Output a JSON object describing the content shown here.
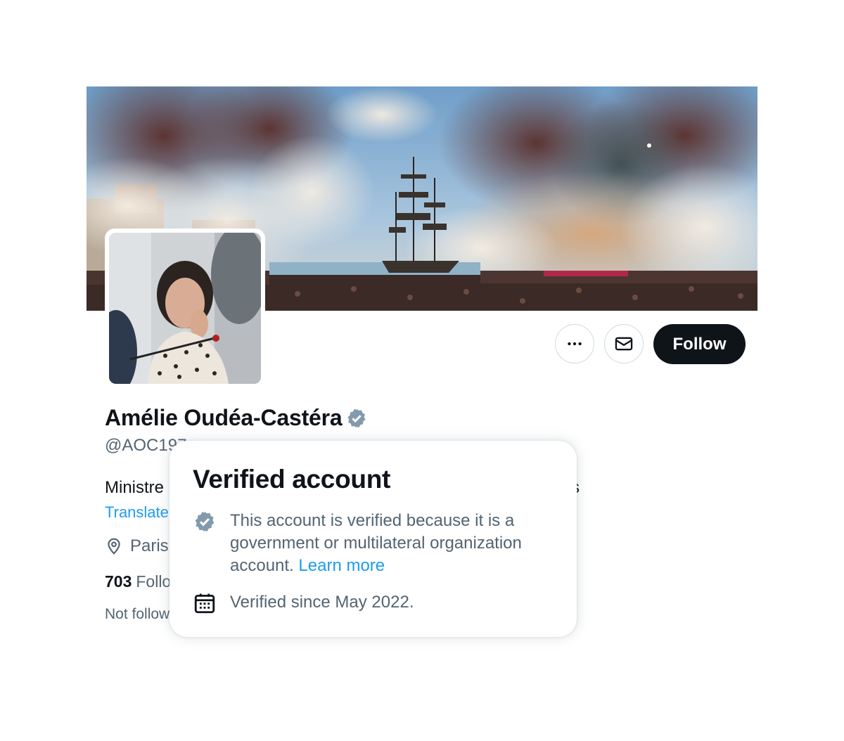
{
  "profile": {
    "display_name": "Amélie Oudéa-Castéra",
    "handle": "@AOC197",
    "bio_start": "Ministre",
    "bio_end": "s",
    "translate_label": "Translate",
    "location": "Paris",
    "followers_count": "703",
    "followers_label": "Follo",
    "not_followed": "Not follow"
  },
  "actions": {
    "more_icon": "more-horizontal-icon",
    "message_icon": "envelope-icon",
    "follow_label": "Follow"
  },
  "verified_popover": {
    "title": "Verified account",
    "reason_text": "This account is verified because it is a government or multilateral organization account.",
    "learn_more_label": "Learn more",
    "since_text": "Verified since May 2022.",
    "badge_color": "#829aab",
    "link_color": "#1d9bf0"
  }
}
